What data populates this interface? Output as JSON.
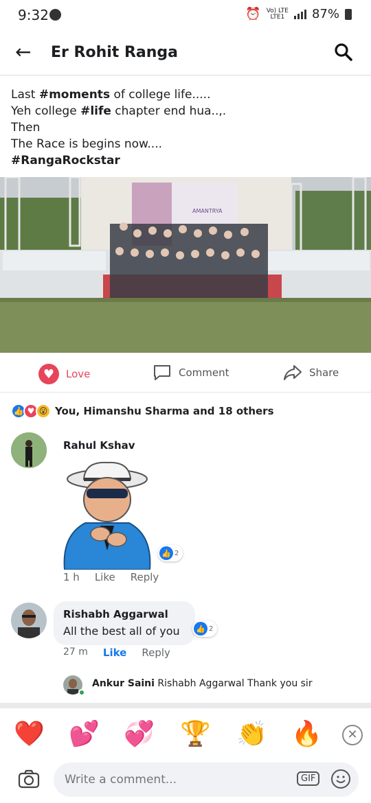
{
  "status_bar": {
    "time": "9:32",
    "network": "Vo) LTE",
    "network_sub": "LTE1",
    "battery": "87%"
  },
  "header": {
    "title": "Er Rohit Ranga"
  },
  "post": {
    "lines": [
      {
        "pre": "Last ",
        "tag": "#moments",
        "post": " of college life....."
      },
      {
        "pre": "Yeh college ",
        "tag": "#life",
        "post": " chapter end hua..,."
      },
      {
        "pre": "Then",
        "tag": "",
        "post": ""
      },
      {
        "pre": "The Race is begins now....",
        "tag": "",
        "post": ""
      },
      {
        "pre": "",
        "tag": "#RangaRockstar",
        "post": ""
      }
    ],
    "photo_banner": "AMANTRYA"
  },
  "actions": {
    "love": "Love",
    "comment": "Comment",
    "share": "Share"
  },
  "reactions": {
    "summary": "You, Himanshu Sharma and 18 others"
  },
  "comments": [
    {
      "author": "Rahul Kshav",
      "time": "1 h",
      "like": "Like",
      "reply": "Reply",
      "like_count": "2"
    },
    {
      "author": "Rishabh Aggarwal",
      "text": "All the best all of you",
      "time": "27 m",
      "like": "Like",
      "reply": "Reply",
      "like_count": "2"
    }
  ],
  "reply": {
    "author": "Ankur Saini",
    "text": "Rishabh Aggarwal Thank you sir"
  },
  "emoji_bar": [
    "❤️",
    "💕",
    "💞",
    "🏆",
    "👏",
    "🔥"
  ],
  "composer": {
    "placeholder": "Write a comment...",
    "gif": "GIF"
  },
  "colors": {
    "love": "#e8445a",
    "like": "#1877f2"
  }
}
